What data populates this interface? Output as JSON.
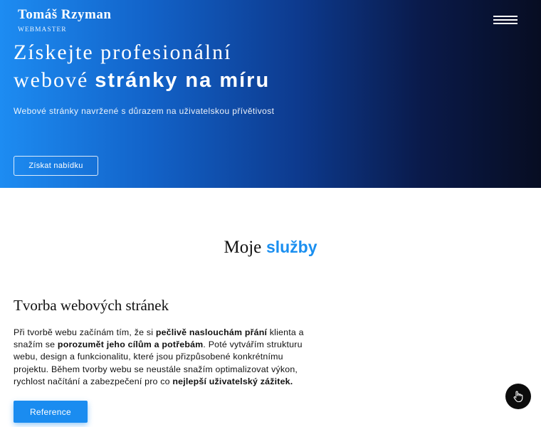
{
  "header": {
    "brand_name": "Tomáš Rzyman",
    "brand_sub": "WEBMASTER",
    "menu_icon": "hamburger-menu-icon"
  },
  "hero": {
    "headline_line1": "Získejte profesionální",
    "headline_line2_regular": "webové",
    "headline_line2_bold": "stránky na míru",
    "subtitle": "Webové stránky navržené s důrazem na uživatelskou přívětivost",
    "cta_label": "Získat nabídku",
    "gradient_colors": [
      "#1d8cf2",
      "#0d3a8e",
      "#070d22"
    ]
  },
  "services": {
    "title_regular": "Moje",
    "title_accent": "služby",
    "accent_color": "#1a8ff0",
    "item_title": "Tvorba webových stránek",
    "text_parts": [
      {
        "t": "Při tvorbě webu začínám tím, že si ",
        "b": false
      },
      {
        "t": "pečlivě naslouchám přání",
        "b": true
      },
      {
        "t": " klienta a snažím se ",
        "b": false
      },
      {
        "t": "porozumět jeho cílům a potřebám",
        "b": true
      },
      {
        "t": ". Poté vytvářím strukturu webu, design a funkcionalitu, které jsou přizpůsobené konkrétnímu projektu. Během tvorby webu se neustále snažím optimalizovat výkon, rychlost načítání a zabezpečení pro co ",
        "b": false
      },
      {
        "t": "nejlepší uživatelský zážitek.",
        "b": true
      }
    ],
    "reference_label": "Reference"
  },
  "floating": {
    "icon": "hand-pointer-icon"
  }
}
